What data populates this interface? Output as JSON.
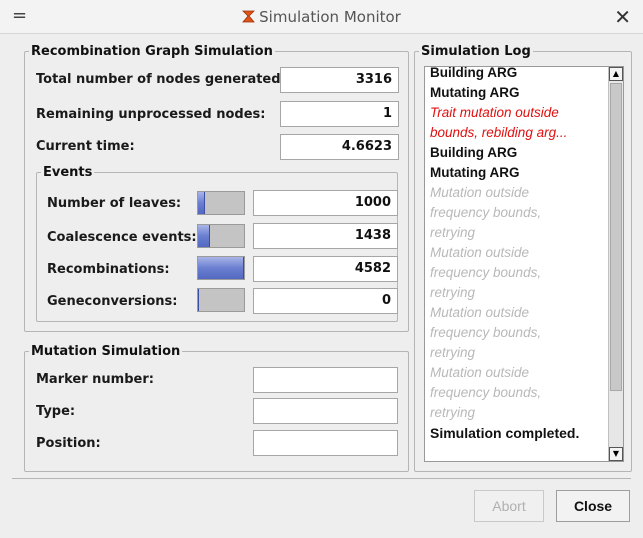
{
  "window": {
    "title": "Simulation Monitor",
    "menu_glyph": "=",
    "close_glyph": "✕"
  },
  "recombination": {
    "legend": "Recombination Graph Simulation",
    "total_nodes_label": "Total number of nodes generated:",
    "total_nodes_value": "3316",
    "remaining_label": "Remaining unprocessed nodes:",
    "remaining_value": "1",
    "time_label": "Current time:",
    "time_value": "4.6623",
    "events": {
      "legend": "Events",
      "rows": [
        {
          "label": "Number of leaves:",
          "value": "1000",
          "fill_fraction": 0.15
        },
        {
          "label": "Coalescence events:",
          "value": "1438",
          "fill_fraction": 0.25
        },
        {
          "label": "Recombinations:",
          "value": "4582",
          "fill_fraction": 1.0
        },
        {
          "label": "Geneconversions:",
          "value": "0",
          "fill_fraction": 0.02
        }
      ]
    }
  },
  "mutation": {
    "legend": "Mutation Simulation",
    "marker_label": "Marker number:",
    "marker_value": "",
    "type_label": "Type:",
    "type_value": "",
    "position_label": "Position:",
    "position_value": ""
  },
  "log": {
    "legend": "Simulation Log",
    "lines": [
      {
        "text": "Building ARG",
        "style": "normal"
      },
      {
        "text": "Mutating ARG",
        "style": "normal"
      },
      {
        "text": "Trait mutation outside",
        "style": "error"
      },
      {
        "text": "bounds, rebilding arg...",
        "style": "error"
      },
      {
        "text": "Building ARG",
        "style": "normal"
      },
      {
        "text": "Mutating ARG",
        "style": "normal"
      },
      {
        "text": "Mutation outside",
        "style": "muted"
      },
      {
        "text": "frequency bounds,",
        "style": "muted"
      },
      {
        "text": "retrying",
        "style": "muted"
      },
      {
        "text": "Mutation outside",
        "style": "muted"
      },
      {
        "text": "frequency bounds,",
        "style": "muted"
      },
      {
        "text": "retrying",
        "style": "muted"
      },
      {
        "text": "Mutation outside",
        "style": "muted"
      },
      {
        "text": "frequency bounds,",
        "style": "muted"
      },
      {
        "text": "retrying",
        "style": "muted"
      },
      {
        "text": "Mutation outside",
        "style": "muted"
      },
      {
        "text": "frequency bounds,",
        "style": "muted"
      },
      {
        "text": "retrying",
        "style": "muted"
      },
      {
        "text": "Simulation completed.",
        "style": "final"
      }
    ],
    "scroll_up_glyph": "▲",
    "scroll_down_glyph": "▼"
  },
  "buttons": {
    "abort_label": "Abort",
    "close_label": "Close"
  },
  "colors": {
    "error_text": "#e01010",
    "muted_text": "#b8b8b8",
    "progress_fill": "#6a7fd0",
    "title_icon": "#e0541a"
  },
  "icons": {
    "title": "simulation-monitor-icon",
    "menu": "menu-icon",
    "close": "close-icon"
  }
}
